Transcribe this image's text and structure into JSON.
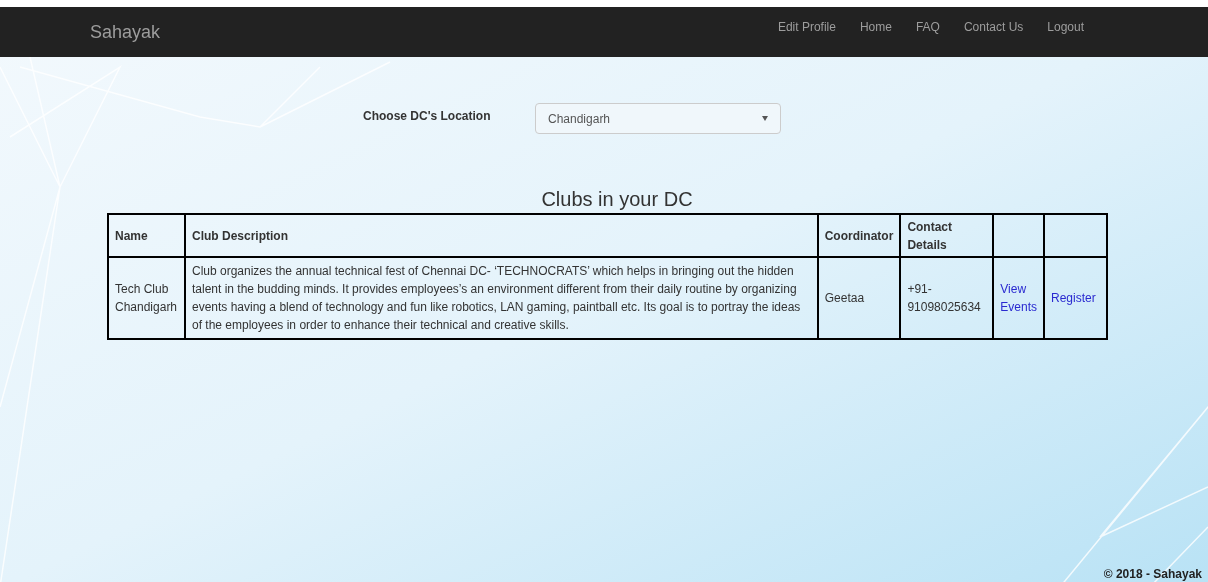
{
  "navbar": {
    "brand": "Sahayak",
    "links": [
      "Edit Profile",
      "Home",
      "FAQ",
      "Contact Us",
      "Logout"
    ]
  },
  "location": {
    "label": "Choose DC's Location",
    "value": "Chandigarh"
  },
  "heading": "Clubs in your DC",
  "table": {
    "columns": [
      "Name",
      "Club Description",
      "Coordinator",
      "Contact Details"
    ],
    "rows": [
      {
        "name": "Tech Club Chandigarh",
        "description": "Club organizes the annual technical fest of Chennai DC- ‘TECHNOCRATS’ which helps in bringing out the hidden talent in the budding minds. It provides employees’s an environment different from their daily routine by organizing events having a blend of technology and fun like robotics, LAN gaming, paintball etc. Its goal is to portray the ideas of the employees in order to enhance their technical and creative skills.",
        "coordinator": "Geetaa",
        "contact": "+91-91098025634",
        "links": [
          "View Events",
          "Register"
        ]
      }
    ]
  },
  "footer": "© 2018 - Sahayak"
}
